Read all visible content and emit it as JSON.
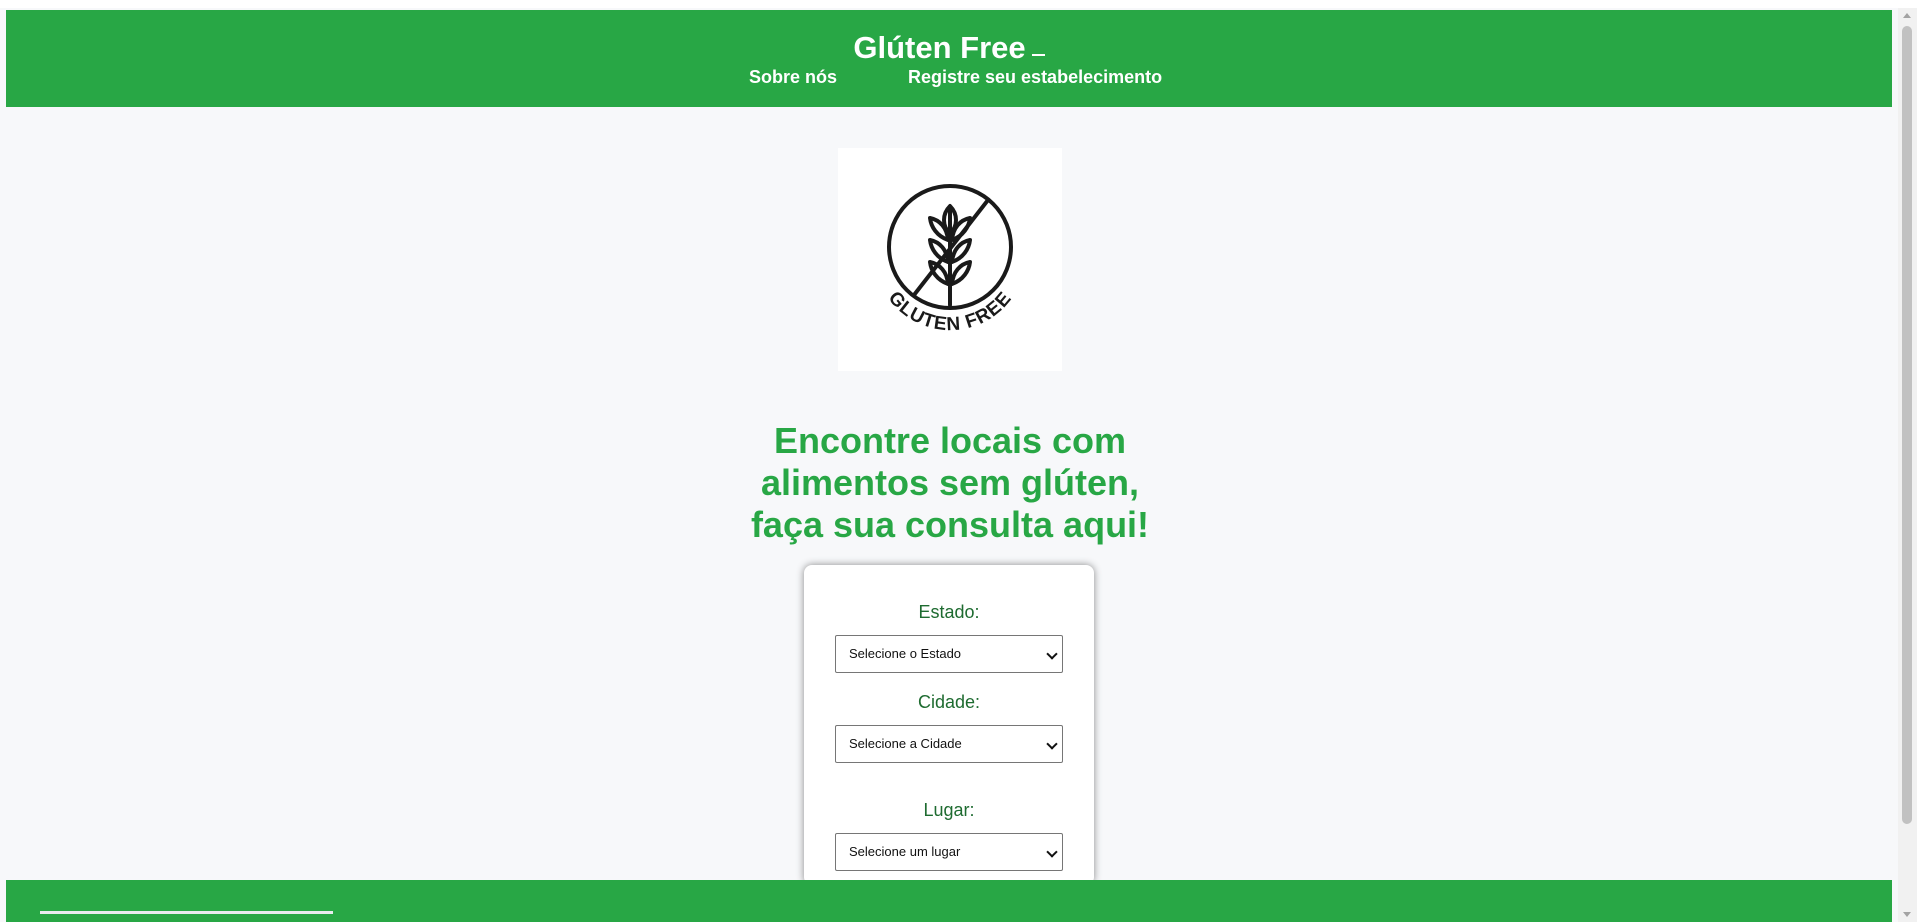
{
  "header": {
    "title": "Glúten Free",
    "nav": [
      {
        "label": "Sobre nós"
      },
      {
        "label": "Registre seu estabelecimento"
      }
    ]
  },
  "logo": {
    "icon": "gluten-free-wheat-icon",
    "text": "GLUTEN FREE"
  },
  "hero": {
    "line1": "Encontre locais com",
    "line2": "alimentos sem glúten,",
    "line3": "faça sua consulta aqui!"
  },
  "search_form": {
    "estado_label": "Estado:",
    "estado_value": "Selecione o Estado",
    "cidade_label": "Cidade:",
    "cidade_value": "Selecione a Cidade",
    "lugar_label": "Lugar:",
    "lugar_value": "Selecione um lugar"
  },
  "colors": {
    "brand_green": "#28a745",
    "label_green": "#1e6b30",
    "background": "#f7f8fa"
  }
}
